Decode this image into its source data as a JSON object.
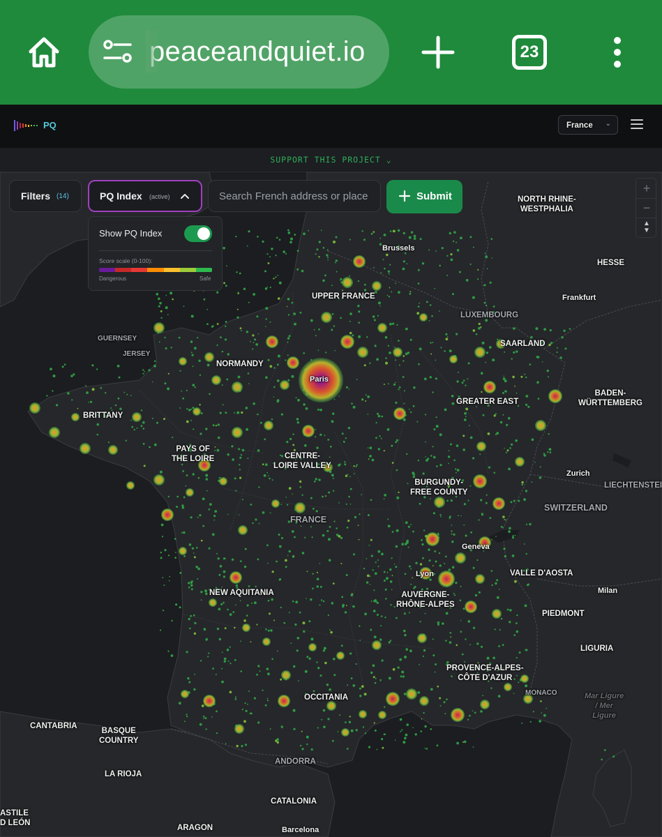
{
  "browser": {
    "url": "peaceandquiet.io",
    "tab_count": "23",
    "icons": [
      "home-icon",
      "tune-icon",
      "plus-icon",
      "tabs-icon",
      "more-vert-icon"
    ]
  },
  "header": {
    "logo_text": "PQ",
    "country_select": "France",
    "menu_icon": "hamburger-icon"
  },
  "support": {
    "label": "SUPPORT THIS PROJECT"
  },
  "controls": {
    "filters_label": "Filters",
    "filters_count": "(14)",
    "pq_label": "PQ Index",
    "pq_status": "(active)",
    "search_placeholder": "Search French address or place",
    "submit_label": "Submit"
  },
  "pq_panel": {
    "show_label": "Show PQ Index",
    "toggle_on": true,
    "scale_label": "Score scale (0-100):",
    "scale_colors": [
      "#6a1b9a",
      "#c62828",
      "#e53935",
      "#fb8c00",
      "#fbc02d",
      "#9ccc3a",
      "#2eb84f"
    ],
    "left_label": "Dangerous",
    "right_label": "Safe"
  },
  "map_controls": {
    "zoom_in": "+",
    "zoom_out": "−",
    "compass": "▲▼"
  },
  "map_labels": {
    "brussels": "Brussels",
    "north_rhine": "NORTH RHINE-\nWESTPHALIA",
    "hesse": "HESSE",
    "upper_france": "UPPER FRANCE",
    "frankfurt": "Frankfurt",
    "luxembourg": "LUXEMBOURG",
    "guernsey": "GUERNSEY",
    "jersey": "JERSEY",
    "saarland": "SAARLAND",
    "normandy": "NORMANDY",
    "paris": "Paris",
    "baden": "BADEN-\nWÜRTTEMBERG",
    "greater_east": "GREATER EAST",
    "brittany": "BRITTANY",
    "pays_loire": "PAYS OF\nTHE LOIRE",
    "centre": "CENTRE-\nLOIRE VALLEY",
    "zurich": "Zurich",
    "liechtenstein": "LIECHTENSTEIN",
    "burgundy": "BURGUNDY-\nFREE COUNTY",
    "switzerland": "SWITZERLAND",
    "france": "FRANCE",
    "geneva": "Geneva",
    "lyon": "Lyon",
    "valle_aosta": "VALLE D'AOSTA",
    "new_aquitania": "NEW AQUITANIA",
    "auvergne": "AUVERGNE-\nRHÔNE-ALPES",
    "milan": "Milan",
    "piedmont": "PIEDMONT",
    "liguria": "LIGURIA",
    "provence": "PROVENCE-ALPES-\nCÔTE D'AZUR",
    "monaco": "MONACO",
    "mar_ligure": "Mar Ligure\n/ Mer\nLigure",
    "occitania": "OCCITANIA",
    "cantabria": "CANTABRIA",
    "basque": "BASQUE\nCOUNTRY",
    "la_rioja": "LA RIOJA",
    "andorra": "ANDORRA",
    "catalonia": "CATALONIA",
    "castile": "ASTILE\nD LEÓN",
    "aragon": "ARAGON",
    "barcelona": "Barcelona"
  },
  "colors": {
    "browser_bar": "#1f8a3c",
    "accent_green": "#1a8a4a",
    "accent_purple": "#a040c0",
    "land": "#26272a",
    "sea": "#1c1d20"
  }
}
